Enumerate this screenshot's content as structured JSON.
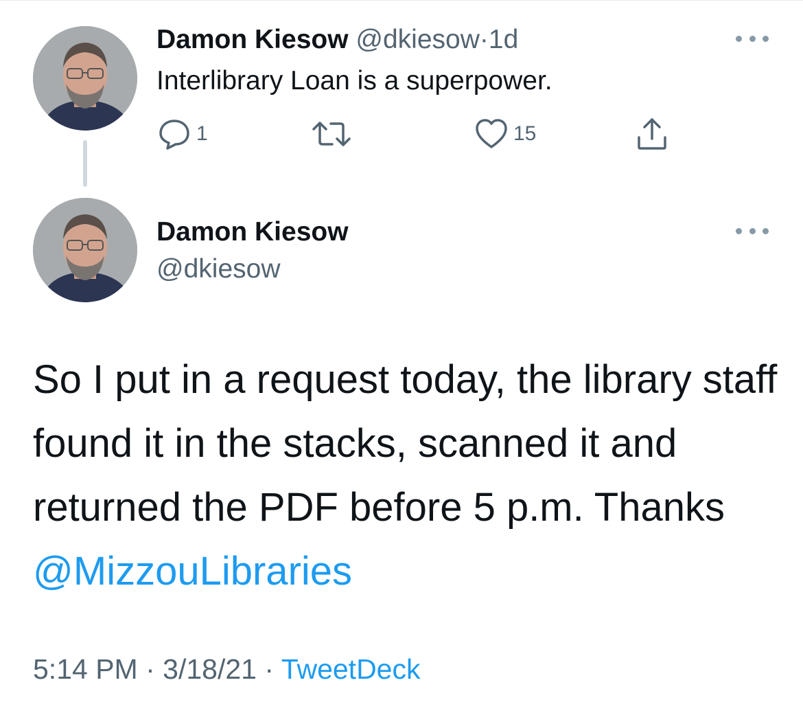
{
  "tweet1": {
    "author_name": "Damon Kiesow",
    "handle": "@dkiesow",
    "separator": "·",
    "age": "1d",
    "text": "Interlibrary Loan is a superpower.",
    "reply_count": "1",
    "retweet_count": "",
    "like_count": "15",
    "avatar_icon": "profile-photo",
    "more_icon": "more-dots-icon"
  },
  "tweet2": {
    "author_name": "Damon Kiesow",
    "handle": "@dkiesow",
    "text_before_mention": "So I put in a request today, the library staff found it in the stacks, scanned it and returned the PDF before 5 p.m. Thanks ",
    "mention": "@MizzouLibraries",
    "time": "5:14 PM",
    "date": "3/18/21",
    "separator": "·",
    "source": "TweetDeck"
  },
  "icons": {
    "reply": "reply-icon",
    "retweet": "retweet-icon",
    "like": "heart-icon",
    "share": "share-icon"
  },
  "colors": {
    "text": "#0f1419",
    "muted": "#536471",
    "link": "#1d9bf0",
    "thread_line": "#cfd9de"
  }
}
